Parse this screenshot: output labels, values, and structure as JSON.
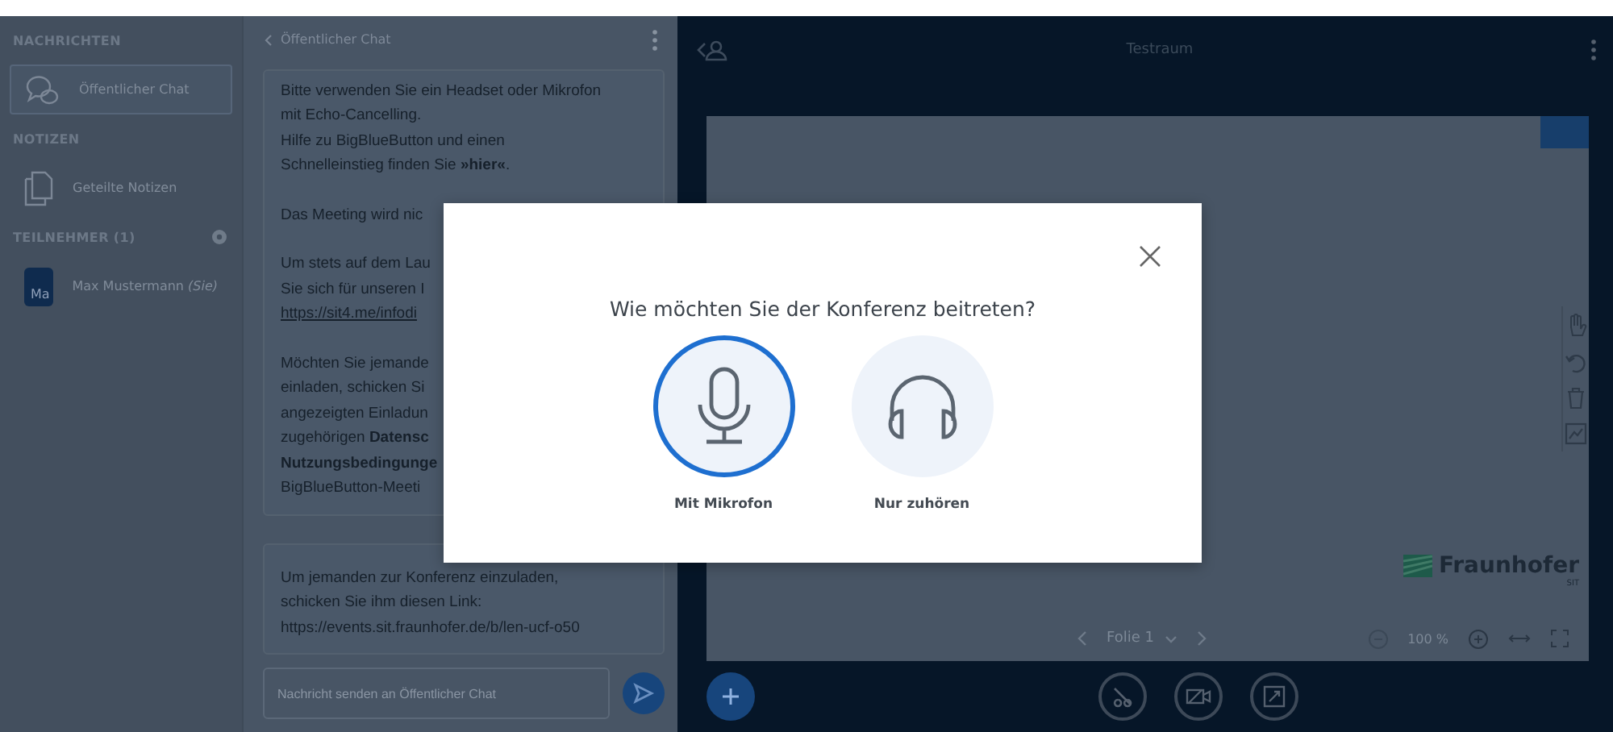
{
  "sidebar": {
    "sections": [
      {
        "heading": "NACHRICHTEN",
        "items": [
          {
            "kind": "chat",
            "label": "Öffentlicher Chat",
            "selected": true
          }
        ]
      },
      {
        "heading": "NOTIZEN",
        "items": [
          {
            "kind": "notes",
            "label": "Geteilte Notizen",
            "selected": false
          }
        ]
      },
      {
        "heading": "TEILNEHMER (1)",
        "items": [
          {
            "kind": "user",
            "avatar": "Ma",
            "label": "Max Mustermann *(Sie)*",
            "selected": false
          }
        ]
      }
    ]
  },
  "chat": {
    "title": "Öffentlicher Chat",
    "messages": [
      {
        "paragraphs": [
          [
            "Bitte verwenden Sie ein Headset oder Mikrofon",
            "mit Echo-Cancelling.",
            "Hilfe zu BigBlueButton und einen",
            "Schnelleinstieg finden Sie **»hier«**."
          ],
          [
            "Das Meeting wird nic"
          ],
          [
            "Um stets auf dem Lau",
            "Sie sich für unseren I",
            "https://sit4.me/infodi"
          ],
          [
            "Möchten Sie jemande",
            "einladen, schicken Si",
            "angezeigten Einladun",
            "zugehörigen **Datensc**",
            "**Nutzungsbedingunge**",
            "BigBlueButton-Meeti"
          ]
        ]
      },
      {
        "paragraphs": [
          [
            "Um jemanden zur Konferenz einzuladen,",
            "schicken Sie ihm diesen Link:",
            "https://events.sit.fraunhofer.de/b/len-ucf-o50"
          ]
        ]
      }
    ],
    "input": {
      "placeholder": "Nachricht senden an Öffentlicher Chat"
    }
  },
  "presentation": {
    "title": "Testraum",
    "logo": {
      "name": "Fraunhofer",
      "sub": "SIT"
    },
    "slide_label": "Folie 1",
    "zoom": "100 %"
  },
  "modal": {
    "title": "Wie möchten Sie der Konferenz beitreten?",
    "options": [
      {
        "kind": "microphone",
        "label": "Mit Mikrofon",
        "selected": true
      },
      {
        "kind": "headphones",
        "label": "Nur zuhören",
        "selected": false
      }
    ]
  }
}
